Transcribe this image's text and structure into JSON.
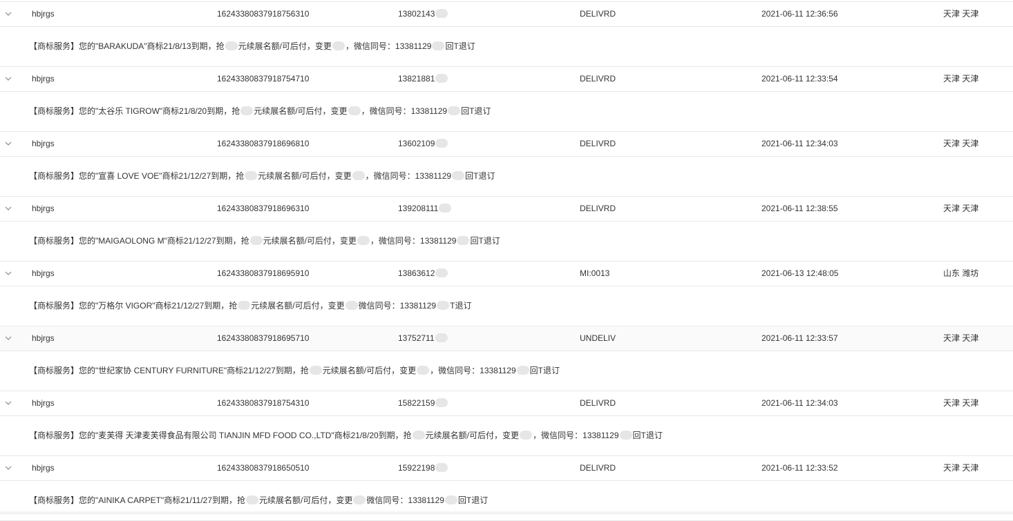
{
  "rows": [
    {
      "user": "hbjrgs",
      "id": "16243380837918756310",
      "phone": "13802143",
      "status": "DELIVRD",
      "time": "2021-06-11 12:36:56",
      "region": "天津 天津",
      "msg": [
        "【商标服务】您的\"BARAKUDA\"商标21/8/13到期，抢",
        "元续展名额/可后付，变更",
        "，微信同号：13381129",
        "回T退订"
      ]
    },
    {
      "user": "hbjrgs",
      "id": "16243380837918754710",
      "phone": "13821881",
      "status": "DELIVRD",
      "time": "2021-06-11 12:33:54",
      "region": "天津 天津",
      "msg": [
        "【商标服务】您的\"太谷乐 TIGROW\"商标21/8/20到期，抢",
        "元续展名额/可后付，变更",
        "，微信同号：13381129",
        "回T退订"
      ]
    },
    {
      "user": "hbjrgs",
      "id": "16243380837918696810",
      "phone": "13602109",
      "status": "DELIVRD",
      "time": "2021-06-11 12:34:03",
      "region": "天津 天津",
      "msg": [
        "【商标服务】您的\"宣喜 LOVE VOE\"商标21/12/27到期，抢",
        "元续展名额/可后付，变更",
        "，微信同号：13381129",
        "回T退订"
      ]
    },
    {
      "user": "hbjrgs",
      "id": "16243380837918696310",
      "phone": "139208111",
      "status": "DELIVRD",
      "time": "2021-06-11 12:38:55",
      "region": "天津 天津",
      "msg": [
        "【商标服务】您的\"MAIGAOLONG M\"商标21/12/27到期，抢",
        "元续展名额/可后付，变更",
        "，微信同号：13381129",
        "回T退订"
      ]
    },
    {
      "user": "hbjrgs",
      "id": "16243380837918695910",
      "phone": "13863612",
      "status": "MI:0013",
      "time": "2021-06-13 12:48:05",
      "region": "山东 潍坊",
      "msg": [
        "【商标服务】您的\"万格尔 VIGOR\"商标21/12/27到期，抢",
        "元续展名额/可后付，变更",
        "微信同号：13381129",
        "T退订"
      ]
    },
    {
      "user": "hbjrgs",
      "id": "16243380837918695710",
      "phone": "13752711",
      "status": "UNDELIV",
      "time": "2021-06-11 12:33:57",
      "region": "天津 天津",
      "msg": [
        "【商标服务】您的\"世纪家协 CENTURY FURNITURE\"商标21/12/27到期，抢",
        "元续展名额/可后付，变更",
        "，微信同号：13381129",
        "回T退订"
      ]
    },
    {
      "user": "hbjrgs",
      "id": "16243380837918754310",
      "phone": "15822159",
      "status": "DELIVRD",
      "time": "2021-06-11 12:34:03",
      "region": "天津 天津",
      "msg": [
        "【商标服务】您的\"麦芙得 天津麦芙得食品有限公司 TIANJIN MFD FOOD CO.,LTD\"商标21/8/20到期，抢",
        "元续展名额/可后付，变更",
        "，微信同号：13381129",
        "回T退订"
      ]
    },
    {
      "user": "hbjrgs",
      "id": "16243380837918650510",
      "phone": "15922198",
      "status": "DELIVRD",
      "time": "2021-06-11 12:33:52",
      "region": "天津 天津",
      "msg": [
        "【商标服务】您的\"AINIKA CARPET\"商标21/11/27到期，抢",
        "元续展名额/可后付，变更",
        "微信同号：13381129",
        "回T退订"
      ]
    }
  ],
  "icons": {
    "expand": "chevron-down-icon"
  },
  "colors": {
    "border": "#e8e8e8",
    "text": "#333333",
    "redaction": "#e6e6e6",
    "row_alt": "#fafafa"
  }
}
